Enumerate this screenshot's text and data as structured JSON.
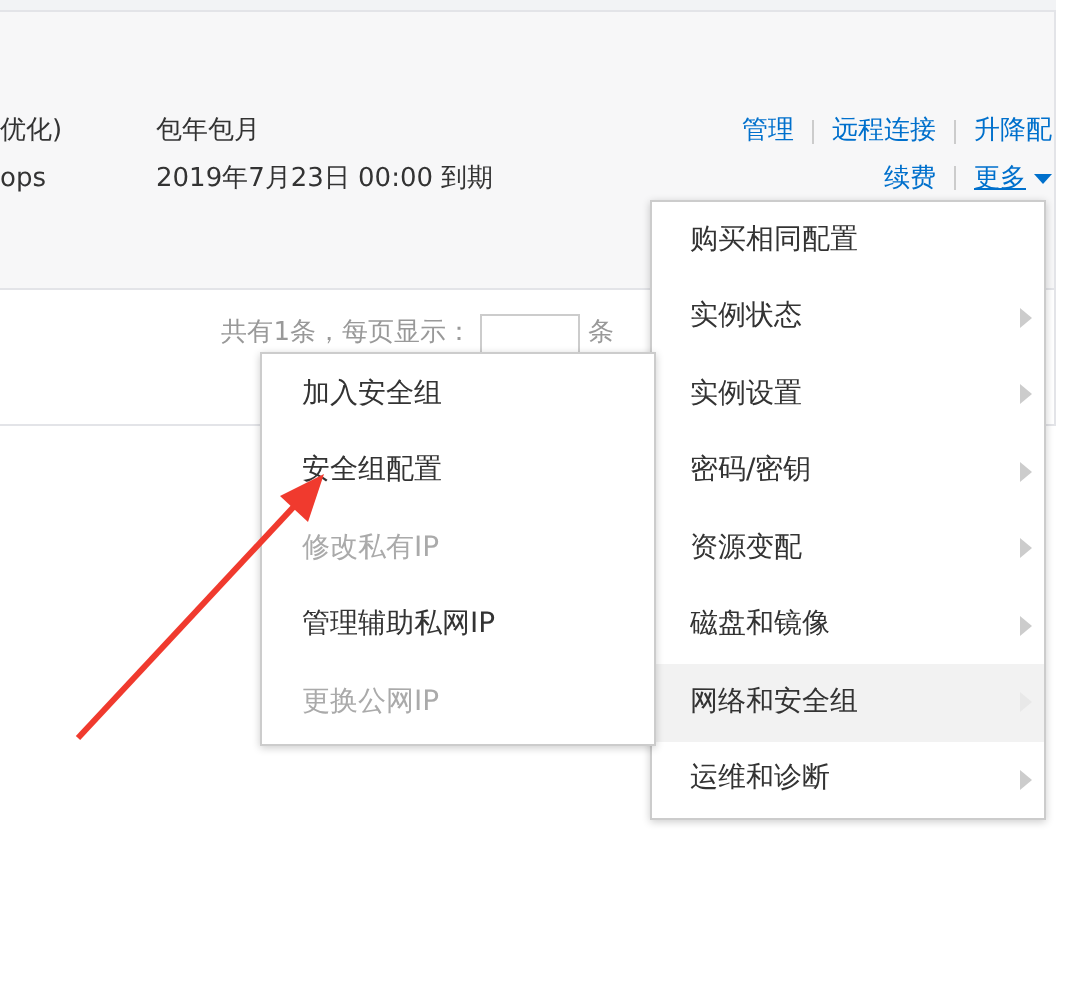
{
  "instance": {
    "name_fragment": "优化)",
    "spec_fragment": "ops",
    "billing": "包年包月",
    "expiry": "2019年7月23日 00:00 到期"
  },
  "actions": [
    [
      {
        "label": "管理"
      },
      {
        "label": "远程连接"
      },
      {
        "label": "升降配"
      }
    ],
    [
      {
        "label": "续费"
      }
    ]
  ],
  "more": {
    "label": "更多",
    "expanded": true
  },
  "pager": {
    "summary": "共有1条，每页显示：",
    "unit": "条"
  },
  "menu": [
    {
      "label": "购买相同配置",
      "has_submenu": false,
      "selected": false
    },
    {
      "label": "实例状态",
      "has_submenu": true,
      "selected": false
    },
    {
      "label": "实例设置",
      "has_submenu": true,
      "selected": false
    },
    {
      "label": "密码/密钥",
      "has_submenu": true,
      "selected": false
    },
    {
      "label": "资源变配",
      "has_submenu": true,
      "selected": false
    },
    {
      "label": "磁盘和镜像",
      "has_submenu": true,
      "selected": false
    },
    {
      "label": "网络和安全组",
      "has_submenu": true,
      "selected": true
    },
    {
      "label": "运维和诊断",
      "has_submenu": true,
      "selected": false
    }
  ],
  "submenu": [
    {
      "label": "加入安全组",
      "disabled": false
    },
    {
      "label": "安全组配置",
      "disabled": false
    },
    {
      "label": "修改私有IP",
      "disabled": true
    },
    {
      "label": "管理辅助私网IP",
      "disabled": false
    },
    {
      "label": "更换公网IP",
      "disabled": true
    }
  ]
}
